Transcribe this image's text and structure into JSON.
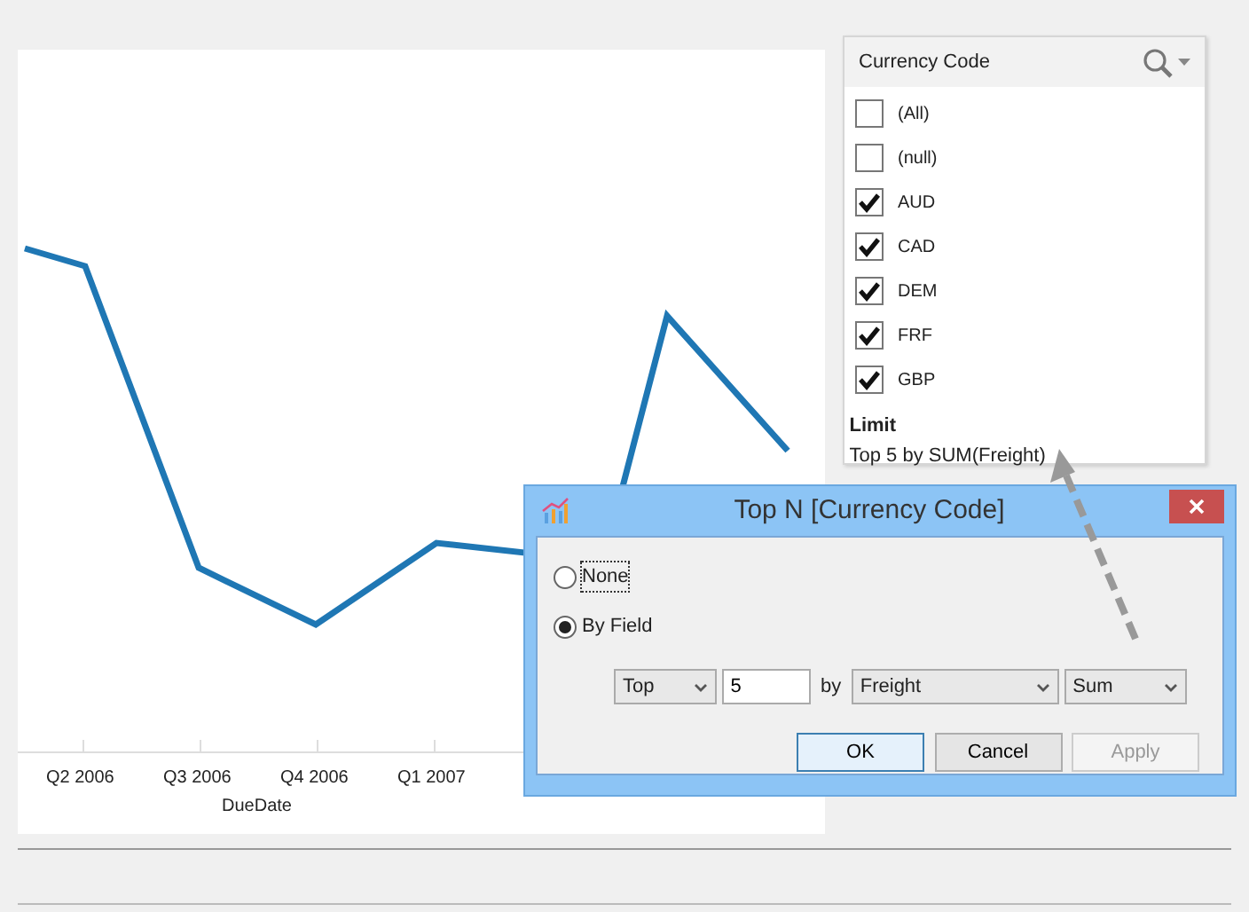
{
  "chart": {
    "x_axis_labels": [
      "Q2 2006",
      "Q3 2006",
      "Q4 2006",
      "Q1 2007"
    ],
    "x_axis_title": "DueDate"
  },
  "filter": {
    "title": "Currency Code",
    "items": [
      {
        "label": "(All)",
        "checked": false
      },
      {
        "label": "(null)",
        "checked": false
      },
      {
        "label": "AUD",
        "checked": true
      },
      {
        "label": "CAD",
        "checked": true
      },
      {
        "label": "DEM",
        "checked": true
      },
      {
        "label": "FRF",
        "checked": true
      },
      {
        "label": "GBP",
        "checked": true
      }
    ],
    "limit_label": "Limit",
    "limit_text": "Top 5 by SUM(Freight)"
  },
  "dialog": {
    "title": "Top N [Currency Code]",
    "options": [
      {
        "label": "None",
        "selected": false
      },
      {
        "label": "By Field",
        "selected": true
      }
    ],
    "direction": "Top",
    "count": "5",
    "by_label": "by",
    "field": "Freight",
    "aggregate": "Sum",
    "buttons": [
      {
        "label": "OK",
        "disabled": false,
        "default": true
      },
      {
        "label": "Cancel",
        "disabled": false,
        "default": false
      },
      {
        "label": "Apply",
        "disabled": true,
        "default": false
      }
    ]
  }
}
